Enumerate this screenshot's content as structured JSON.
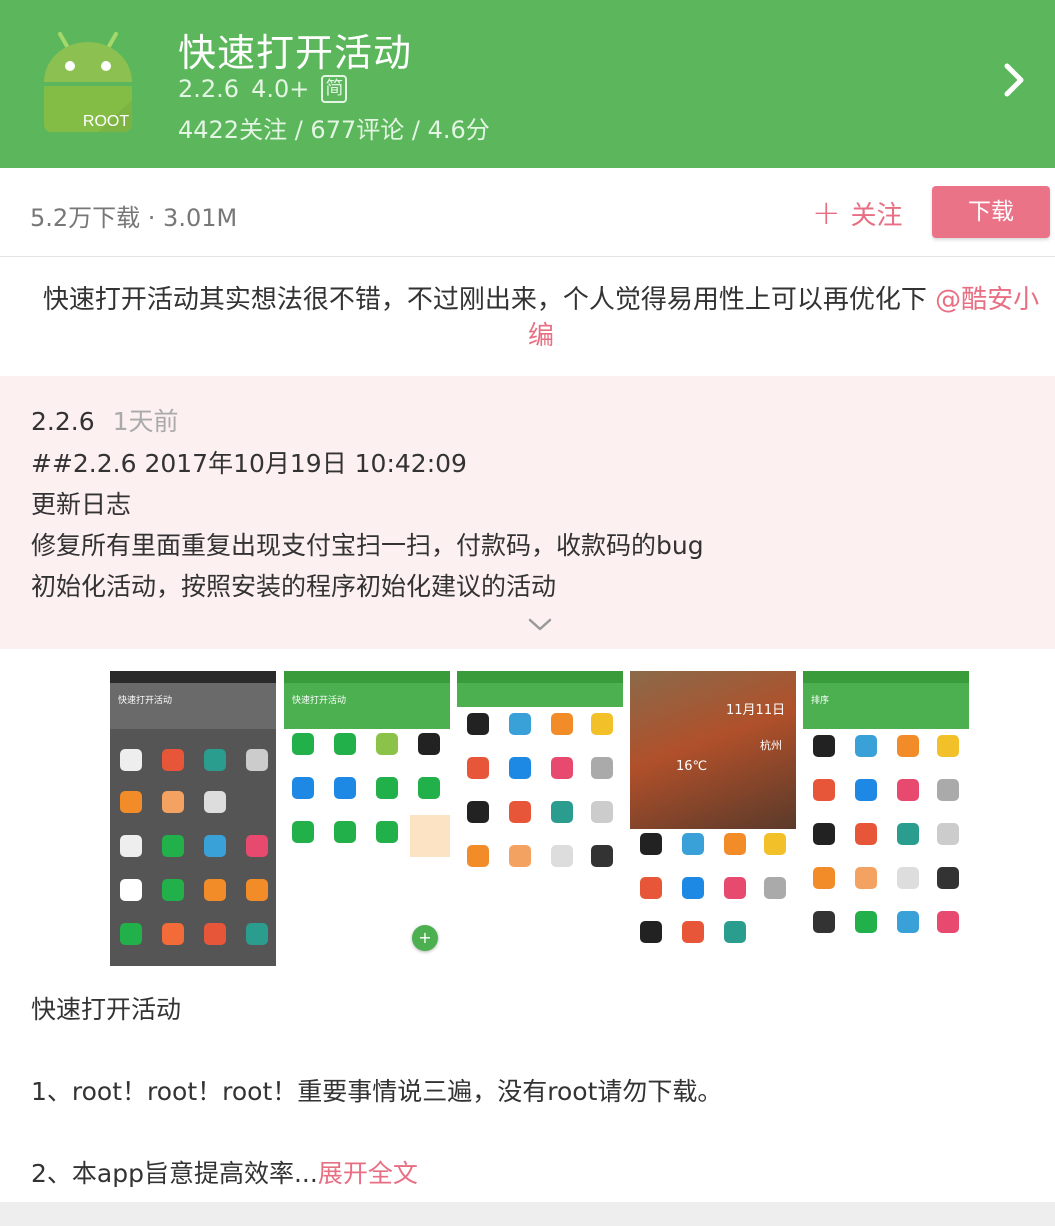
{
  "header": {
    "app_name": "快速打开活动",
    "version": "2.2.6",
    "android_req": "4.0+",
    "lang_badge": "简",
    "stats": "4422关注 / 677评论 / 4.6分",
    "icon_label": "ROOT",
    "colors": {
      "header_bg": "#5cb75c",
      "accent_pink": "#ea7387"
    }
  },
  "download_bar": {
    "info": "5.2万下载 · 3.01M",
    "follow_label": "关注",
    "download_label": "下载"
  },
  "review": {
    "text": "快速打开活动其实想法很不错，不过刚出来，个人觉得易用性上可以再优化下 ",
    "mention": "@酷安小编"
  },
  "changelog": {
    "version": "2.2.6",
    "time_ago": "1天前",
    "lines": [
      "##2.2.6 2017年10月19日 10:42:09",
      "更新日志",
      "修复所有里面重复出现支付宝扫一扫，付款码，收款码的bug",
      "初始化活动，按照安装的程序初始化建议的活动"
    ]
  },
  "screenshots": {
    "shot1_title": "快速打开活动",
    "shot2_title": "快速打开活动",
    "shot5_title": "排序",
    "weather_date": "11月11日",
    "weather_temp": "16℃",
    "weather_city": "杭州"
  },
  "description": {
    "title": "快速打开活动",
    "line1": "1、root！root！root！重要事情说三遍，没有root请勿下载。",
    "line2": "2、本app旨意提高效率...",
    "expand_label": "展开全文"
  }
}
